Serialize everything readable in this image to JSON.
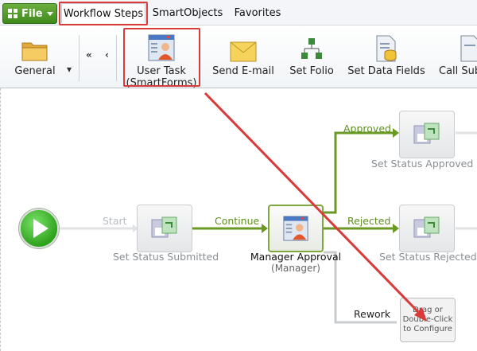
{
  "menu": {
    "file_label": "File",
    "tabs": [
      {
        "label": "Workflow Steps"
      },
      {
        "label": "SmartObjects"
      },
      {
        "label": "Favorites"
      }
    ]
  },
  "ribbon": {
    "general_label": "General",
    "buttons": [
      {
        "label_line1": "User Task",
        "label_line2": "(SmartForms)"
      },
      {
        "label_line1": "Send E-mail"
      },
      {
        "label_line1": "Set Folio"
      },
      {
        "label_line1": "Set Data Fields"
      },
      {
        "label_line1": "Call Sub"
      }
    ]
  },
  "workflow": {
    "start_line_label": "Start",
    "continue_label": "Continue",
    "approved_label": "Approved",
    "rejected_label": "Rejected",
    "rework_label": "Rework",
    "nodes": {
      "set_status_submitted": "Set Status Submitted",
      "manager_approval": "Manager Approval",
      "manager_approval_sub": "(Manager)",
      "set_status_approved": "Set Status Approved",
      "set_status_rejected": "Set Status Rejected",
      "placeholder_line1": "Drag or",
      "placeholder_line2": "Double-Click",
      "placeholder_line3": "to Configure"
    }
  },
  "colors": {
    "accent_green": "#6a9a23",
    "highlight_red": "#d93a3a"
  }
}
